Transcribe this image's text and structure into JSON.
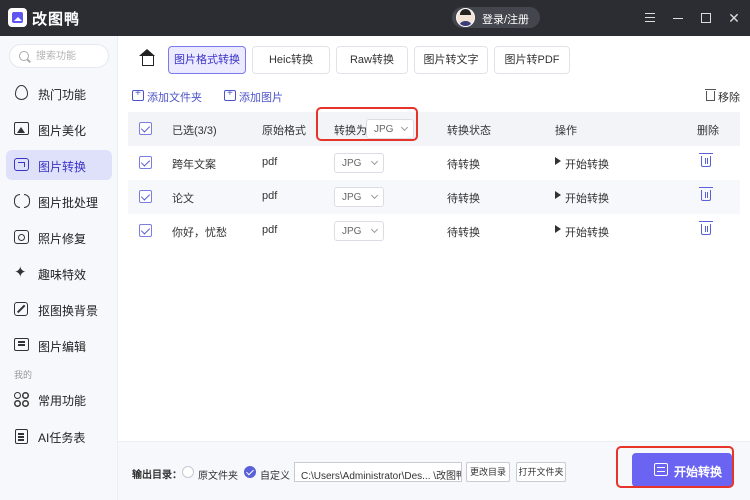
{
  "app": {
    "title": "改图鸭",
    "login_label": "登录/注册"
  },
  "search": {
    "placeholder": "搜索功能"
  },
  "sidebar": {
    "items": [
      {
        "label": "热门功能",
        "icon": "fire-icon"
      },
      {
        "label": "图片美化",
        "icon": "image-icon"
      },
      {
        "label": "图片转换",
        "icon": "convert-icon",
        "active": true
      },
      {
        "label": "图片批处理",
        "icon": "batch-icon"
      },
      {
        "label": "照片修复",
        "icon": "repair-icon"
      },
      {
        "label": "趣味特效",
        "icon": "sparkle-icon"
      },
      {
        "label": "抠图换背景",
        "icon": "cutout-icon"
      },
      {
        "label": "图片编辑",
        "icon": "edit-icon"
      }
    ],
    "group_label": "我的",
    "my_items": [
      {
        "label": "常用功能",
        "icon": "grid-icon"
      },
      {
        "label": "AI任务表",
        "icon": "list-icon"
      }
    ]
  },
  "tabs": [
    {
      "label": "图片格式转换",
      "active": true
    },
    {
      "label": "Heic转换"
    },
    {
      "label": "Raw转换"
    },
    {
      "label": "图片转文字"
    },
    {
      "label": "图片转PDF"
    }
  ],
  "toolbar": {
    "add_folder": "添加文件夹",
    "add_image": "添加图片",
    "remove": "移除"
  },
  "table": {
    "headers": {
      "selected": "已选(3/3)",
      "original_format": "原始格式",
      "convert_to": "转换为",
      "convert_to_value": "JPG",
      "status": "转换状态",
      "operation": "操作",
      "delete": "删除"
    },
    "rows": [
      {
        "name": "跨年文案",
        "format": "pdf",
        "target": "JPG",
        "status": "待转换",
        "action": "开始转换"
      },
      {
        "name": "论文",
        "format": "pdf",
        "target": "JPG",
        "status": "待转换",
        "action": "开始转换"
      },
      {
        "name": "你好，忧愁",
        "format": "pdf",
        "target": "JPG",
        "status": "待转换",
        "action": "开始转换"
      }
    ]
  },
  "footer": {
    "output_label": "输出目录：",
    "option_original": "原文件夹",
    "option_custom": "自定义",
    "path": "C:\\Users\\Administrator\\Des... \\改图鸭",
    "change_dir": "更改目录",
    "open_folder": "打开文件夹",
    "start_button": "开始转换"
  },
  "colors": {
    "accent": "#6b63f2",
    "highlight": "#e6342b",
    "titlebar": "#2b2d33"
  }
}
